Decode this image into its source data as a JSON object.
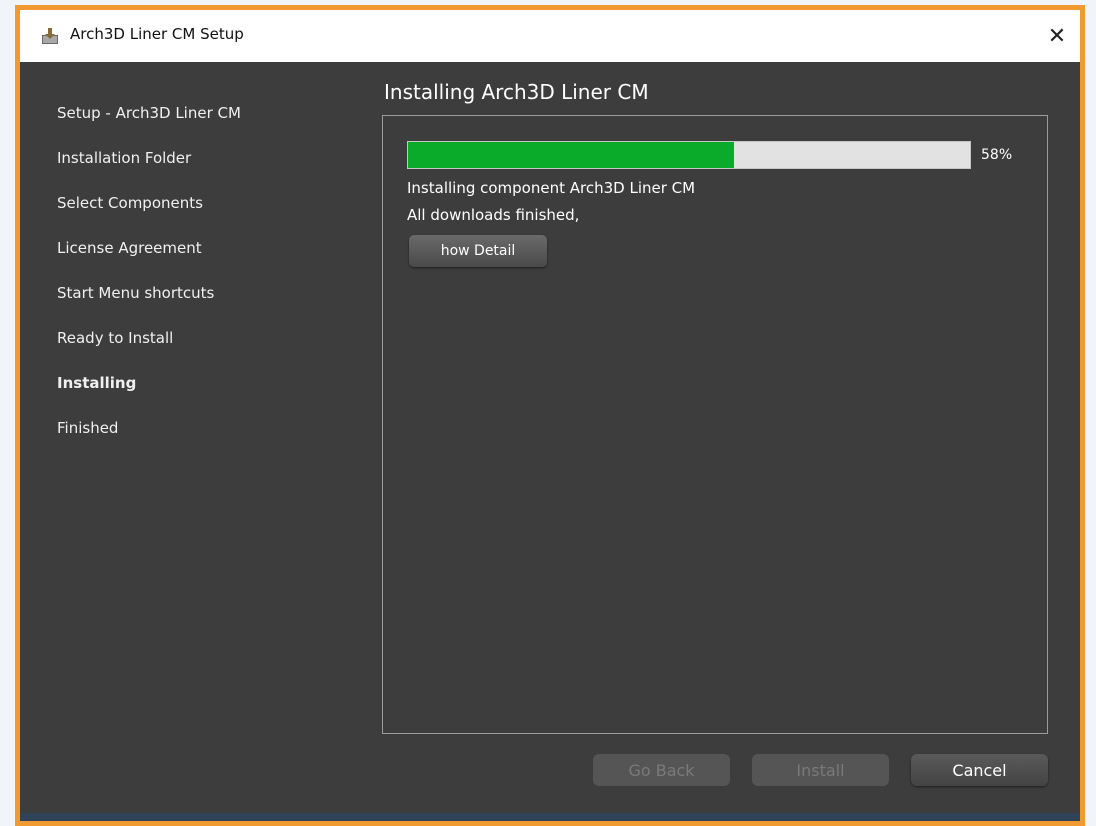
{
  "window": {
    "title": "Arch3D Liner CM Setup",
    "close_glyph": "✕",
    "accent_border": "#f29a32"
  },
  "sidebar": {
    "steps": [
      {
        "label": "Setup - Arch3D Liner CM",
        "active": false
      },
      {
        "label": "Installation Folder",
        "active": false
      },
      {
        "label": "Select Components",
        "active": false
      },
      {
        "label": "License Agreement",
        "active": false
      },
      {
        "label": "Start Menu shortcuts",
        "active": false
      },
      {
        "label": "Ready to Install",
        "active": false
      },
      {
        "label": "Installing",
        "active": true
      },
      {
        "label": "Finished",
        "active": false
      }
    ]
  },
  "main": {
    "heading": "Installing Arch3D Liner CM",
    "progress": {
      "percent_value": 58,
      "percent_label": "58%",
      "fill_color": "#0aab2a"
    },
    "status_lines": [
      "Installing component Arch3D Liner CM",
      "All downloads finished,"
    ],
    "detail_button_label": "how Detail"
  },
  "footer": {
    "back_label": "Go Back",
    "install_label": "Install",
    "cancel_label": "Cancel"
  },
  "icons": {
    "app_icon": "installer-box-icon",
    "close_icon": "close-icon"
  }
}
